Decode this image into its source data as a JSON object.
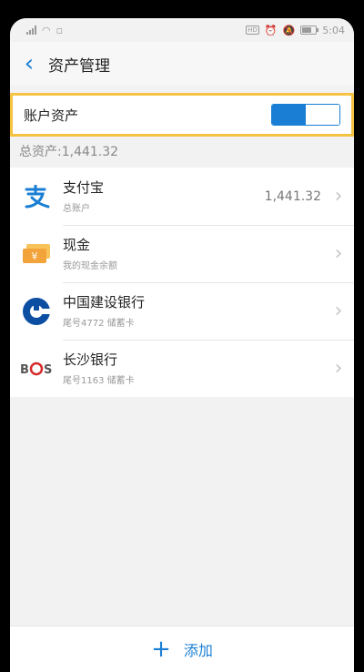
{
  "status": {
    "time": "5:04",
    "hd": "HD"
  },
  "header": {
    "title": "资产管理"
  },
  "toggle": {
    "label": "账户资产"
  },
  "total": {
    "text": "总资产:1,441.32"
  },
  "accounts": [
    {
      "name": "支付宝",
      "sub": "总账户",
      "amount": "1,441.32",
      "icon": "alipay-icon"
    },
    {
      "name": "现金",
      "sub": "我的现金余额",
      "amount": "",
      "icon": "cash-icon"
    },
    {
      "name": "中国建设银行",
      "sub": "尾号4772  储蓄卡",
      "amount": "",
      "icon": "ccb-icon"
    },
    {
      "name": "长沙银行",
      "sub": "尾号1163  储蓄卡",
      "amount": "",
      "icon": "bcs-icon"
    }
  ],
  "footer": {
    "add_label": "添加"
  },
  "colors": {
    "accent": "#1a7fd4",
    "highlight": "#f5c242"
  }
}
